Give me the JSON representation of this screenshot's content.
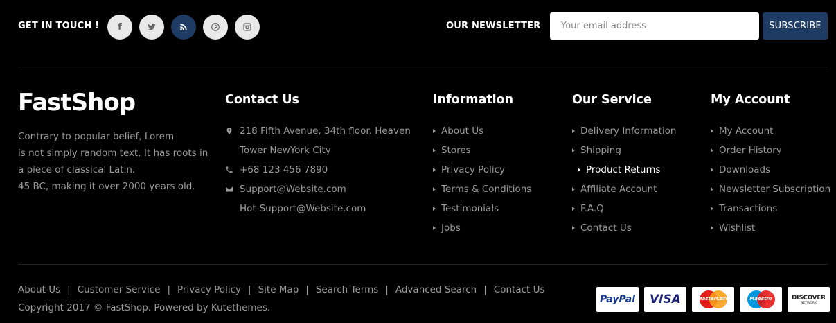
{
  "top": {
    "get_in_touch": "GET IN TOUCH !",
    "social": [
      {
        "glyph": "f",
        "icon": "facebook-icon"
      },
      {
        "glyph": "t",
        "icon": "twitter-icon"
      },
      {
        "glyph": "",
        "icon": "rss-icon",
        "active": true
      },
      {
        "glyph": "p",
        "icon": "pinterest-icon"
      },
      {
        "glyph": "",
        "icon": "instagram-icon"
      }
    ],
    "newsletter_label": "OUR NEWSLETTER",
    "email_placeholder": "Your email address",
    "subscribe_label": "SUBSCRIBE",
    "active_color": "#1e3b64"
  },
  "brand": {
    "name": "FastShop",
    "about_lines": [
      "Contrary to popular belief, Lorem",
      "is not simply random text. It has roots in",
      "a piece of classical Latin.",
      "45 BC, making it over 2000 years old."
    ]
  },
  "contact": {
    "title": "Contact Us",
    "address_line1": "218 Fifth Avenue, 34th floor. Heaven",
    "address_line2": "Tower NewYork City",
    "phone": "+68 123 456 7890",
    "email1": "Support@Website.com",
    "email2": "Hot-Support@Website.com"
  },
  "columns": [
    {
      "title": "Information",
      "items": [
        "About Us",
        "Stores",
        "Privacy Policy",
        "Terms & Conditions",
        "Testimonials",
        "Jobs"
      ]
    },
    {
      "title": "Our Service",
      "items": [
        "Delivery Information",
        "Shipping",
        "Product Returns",
        "Affiliate Account",
        "F.A.Q",
        "Contact Us"
      ],
      "highlighted": 2
    },
    {
      "title": "My Account",
      "items": [
        "My Account",
        "Order History",
        "Downloads",
        "Newsletter Subscription",
        "Transactions",
        "Wishlist"
      ]
    }
  ],
  "bottom": {
    "links": [
      "About Us",
      "Customer Service",
      "Privacy Policy",
      "Site Map",
      "Search Terms",
      "Advanced Search",
      "Contact Us"
    ],
    "copyright": "Copyright 2017 © FastShop. Powered by Kutethemes.",
    "cards": [
      {
        "label": "PayPal",
        "icon": "paypal-icon"
      },
      {
        "label": "VISA",
        "icon": "visa-icon"
      },
      {
        "label": "MasterCard",
        "icon": "mastercard-icon"
      },
      {
        "label": "Maestro",
        "icon": "maestro-icon"
      },
      {
        "label": "DISCOVER",
        "sub": "NETWORK",
        "icon": "discover-icon"
      }
    ]
  }
}
